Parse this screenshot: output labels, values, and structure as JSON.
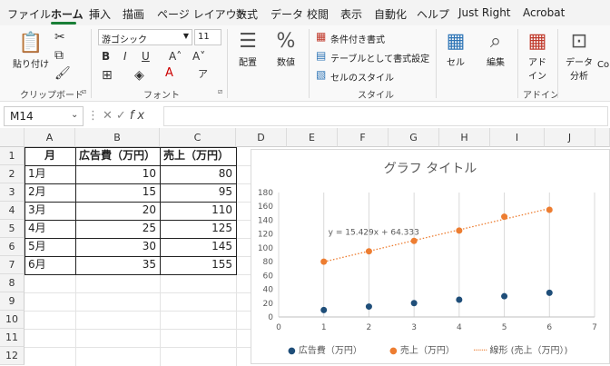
{
  "menu": {
    "tabs": [
      "ファイル",
      "ホーム",
      "挿入",
      "描画",
      "ページ レイアウト",
      "数式",
      "データ",
      "校閲",
      "表示",
      "自動化",
      "ヘルプ",
      "Just Right",
      "Acrobat"
    ],
    "active": "ホーム"
  },
  "ribbon": {
    "clipboard": {
      "paste_label": "貼り付け",
      "group_label": "クリップボード"
    },
    "font": {
      "font_name": "游ゴシック",
      "font_size": "11",
      "group_label": "フォント",
      "bold": "B",
      "italic": "I",
      "underline": "U",
      "grow": "A˄",
      "shrink": "A˅"
    },
    "alignment": {
      "label": "配置"
    },
    "number": {
      "label": "数値",
      "icon_text": "%"
    },
    "styles": {
      "conditional": "条件付き書式",
      "table_format": "テーブルとして書式設定",
      "cell_style": "セルのスタイル",
      "group_label": "スタイル"
    },
    "cells": {
      "label": "セル"
    },
    "editing": {
      "label": "編集"
    },
    "addin": {
      "label": "アド\nイン",
      "line1": "アド",
      "line2": "イン",
      "group_label": "アドイン"
    },
    "data_analysis": {
      "line1": "データ",
      "line2": "分析"
    },
    "copilot": "Co"
  },
  "formula_bar": {
    "name_box": "M14",
    "fx": "fx",
    "value": ""
  },
  "grid": {
    "columns": [
      "A",
      "B",
      "C",
      "D",
      "E",
      "F",
      "G",
      "H",
      "I",
      "J"
    ],
    "rows": [
      "1",
      "2",
      "3",
      "4",
      "5",
      "6",
      "7",
      "8",
      "9",
      "10",
      "11",
      "12"
    ],
    "table": {
      "headers": [
        "月",
        "広告費（万円）",
        "売上（万円）"
      ],
      "rows": [
        [
          "1月",
          "10",
          "80"
        ],
        [
          "2月",
          "15",
          "95"
        ],
        [
          "3月",
          "20",
          "110"
        ],
        [
          "4月",
          "25",
          "125"
        ],
        [
          "5月",
          "30",
          "145"
        ],
        [
          "6月",
          "35",
          "155"
        ]
      ]
    }
  },
  "chart_data": {
    "type": "scatter",
    "title": "グラフ タイトル",
    "x": [
      1,
      2,
      3,
      4,
      5,
      6
    ],
    "series": [
      {
        "name": "広告費（万円）",
        "values": [
          10,
          15,
          20,
          25,
          30,
          35
        ],
        "color": "#1f4e79"
      },
      {
        "name": "売上（万円）",
        "values": [
          80,
          95,
          110,
          125,
          145,
          155
        ],
        "color": "#ed7d31"
      }
    ],
    "trendline": {
      "name": "線形 (売上（万円）)",
      "equation": "y = 15.429x + 64.333",
      "slope": 15.429,
      "intercept": 64.333,
      "color": "#ed7d31"
    },
    "xlim": [
      0,
      7
    ],
    "ylim": [
      0,
      180
    ],
    "xticks": [
      0,
      1,
      2,
      3,
      4,
      5,
      6,
      7
    ],
    "yticks": [
      0,
      20,
      40,
      60,
      80,
      100,
      120,
      140,
      160,
      180
    ],
    "grid": "vertical",
    "legend": "bottom"
  }
}
